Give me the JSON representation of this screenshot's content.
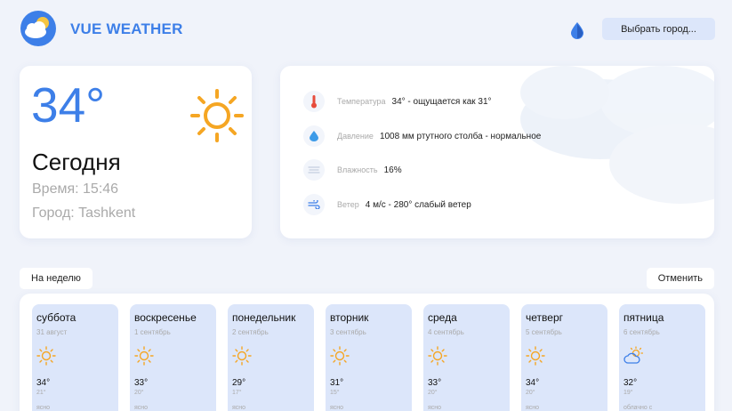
{
  "header": {
    "brand": "VUE WEATHER",
    "city_button_label": "Выбрать город..."
  },
  "colors": {
    "accent": "#3d7fe8",
    "sun": "#f5a623",
    "card": "#ffffff",
    "day_card": "#dce6fa",
    "background": "#f0f3fa"
  },
  "icons": {
    "logo": "cloud-sun-logo-icon",
    "theme": "water-drop-icon",
    "today_weather": "sun-icon"
  },
  "today": {
    "temperature": "34°",
    "label": "Сегодня",
    "time": "Время: 15:46",
    "city": "Город: Tashkent"
  },
  "details": [
    {
      "icon": "thermometer-icon",
      "label": "Температура",
      "value": "34° - ощущается как 31°"
    },
    {
      "icon": "pressure-drop-icon",
      "label": "Давление",
      "value": "1008 мм ртутного столба - нормальное"
    },
    {
      "icon": "humidity-icon",
      "label": "Влажность",
      "value": "16%"
    },
    {
      "icon": "wind-icon",
      "label": "Ветер",
      "value": "4 м/с - 280° слабый ветер"
    }
  ],
  "tabs": {
    "week": "На неделю",
    "cancel": "Отменить"
  },
  "week": [
    {
      "day": "суббота",
      "date": "31 август",
      "temp": "34°",
      "feels": "21°",
      "desc": "ясно",
      "icon": "sun-icon"
    },
    {
      "day": "воскресенье",
      "date": "1 сентябрь",
      "temp": "33°",
      "feels": "20°",
      "desc": "ясно",
      "icon": "sun-icon"
    },
    {
      "day": "понедельник",
      "date": "2 сентябрь",
      "temp": "29°",
      "feels": "17°",
      "desc": "ясно",
      "icon": "sun-icon"
    },
    {
      "day": "вторник",
      "date": "3 сентябрь",
      "temp": "31°",
      "feels": "15°",
      "desc": "ясно",
      "icon": "sun-icon"
    },
    {
      "day": "среда",
      "date": "4 сентябрь",
      "temp": "33°",
      "feels": "20°",
      "desc": "ясно",
      "icon": "sun-icon"
    },
    {
      "day": "четверг",
      "date": "5 сентябрь",
      "temp": "34°",
      "feels": "20°",
      "desc": "ясно",
      "icon": "sun-icon"
    },
    {
      "day": "пятница",
      "date": "6 сентябрь",
      "temp": "32°",
      "feels": "19°",
      "desc": "облачно с",
      "icon": "partly-cloudy-icon"
    }
  ]
}
